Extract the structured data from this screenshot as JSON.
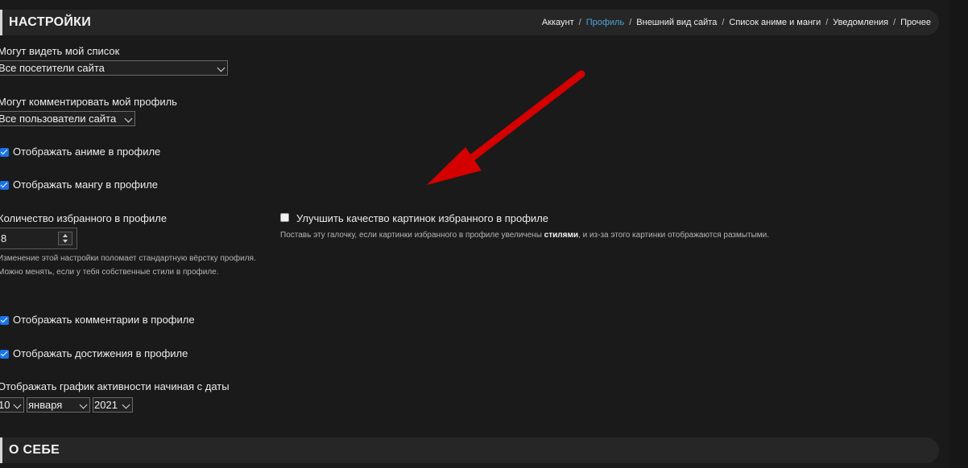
{
  "header": {
    "title": "НАСТРОЙКИ",
    "tabs": [
      {
        "label": "Аккаунт",
        "active": false
      },
      {
        "label": "Профиль",
        "active": true
      },
      {
        "label": "Внешний вид сайта",
        "active": false
      },
      {
        "label": "Список аниме и манги",
        "active": false
      },
      {
        "label": "Уведомления",
        "active": false
      },
      {
        "label": "Прочее",
        "active": false
      }
    ],
    "separator": "/"
  },
  "settings": {
    "list_visibility": {
      "label": "Могут видеть мой список",
      "value": "Все посетители сайта"
    },
    "profile_comments": {
      "label": "Могут комментировать мой профиль",
      "value": "Все пользователи сайта"
    },
    "show_anime": {
      "label": "Отображать аниме в профиле",
      "checked": true
    },
    "show_manga": {
      "label": "Отображать мангу в профиле",
      "checked": true
    },
    "favorites_count": {
      "label": "Количество избранного в профиле",
      "value": "8",
      "hint_line1": "Изменение этой настройки поломает стандартную вёрстку профиля.",
      "hint_line2": "Можно менять, если у тебя собственные стили в профиле."
    },
    "improve_images": {
      "label": "Улучшить качество картинок избранного в профиле",
      "checked": false,
      "hint_before": "Поставь эту галочку, если картинки избранного в профиле увеличены ",
      "hint_bold": "стилями",
      "hint_after": ", и из-за этого картинки отображаются размытыми."
    },
    "show_comments": {
      "label": "Отображать комментарии в профиле",
      "checked": true
    },
    "show_achievements": {
      "label": "Отображать достижения в профиле",
      "checked": true
    },
    "activity_graph": {
      "label": "Отображать график активности начиная с даты",
      "day": "10",
      "month": "января",
      "year": "2021"
    }
  },
  "about": {
    "title": "О СЕБЕ"
  },
  "colors": {
    "background": "#1a1a1a",
    "header_bg": "#262626",
    "active_tab": "#4ea3d8",
    "checkbox_checked": "#1a73e8",
    "annotation_arrow": "#d40000"
  },
  "icons": [
    "chevron-down-icon",
    "checkmark-icon",
    "spinner-arrows-icon",
    "annotation-arrow"
  ]
}
